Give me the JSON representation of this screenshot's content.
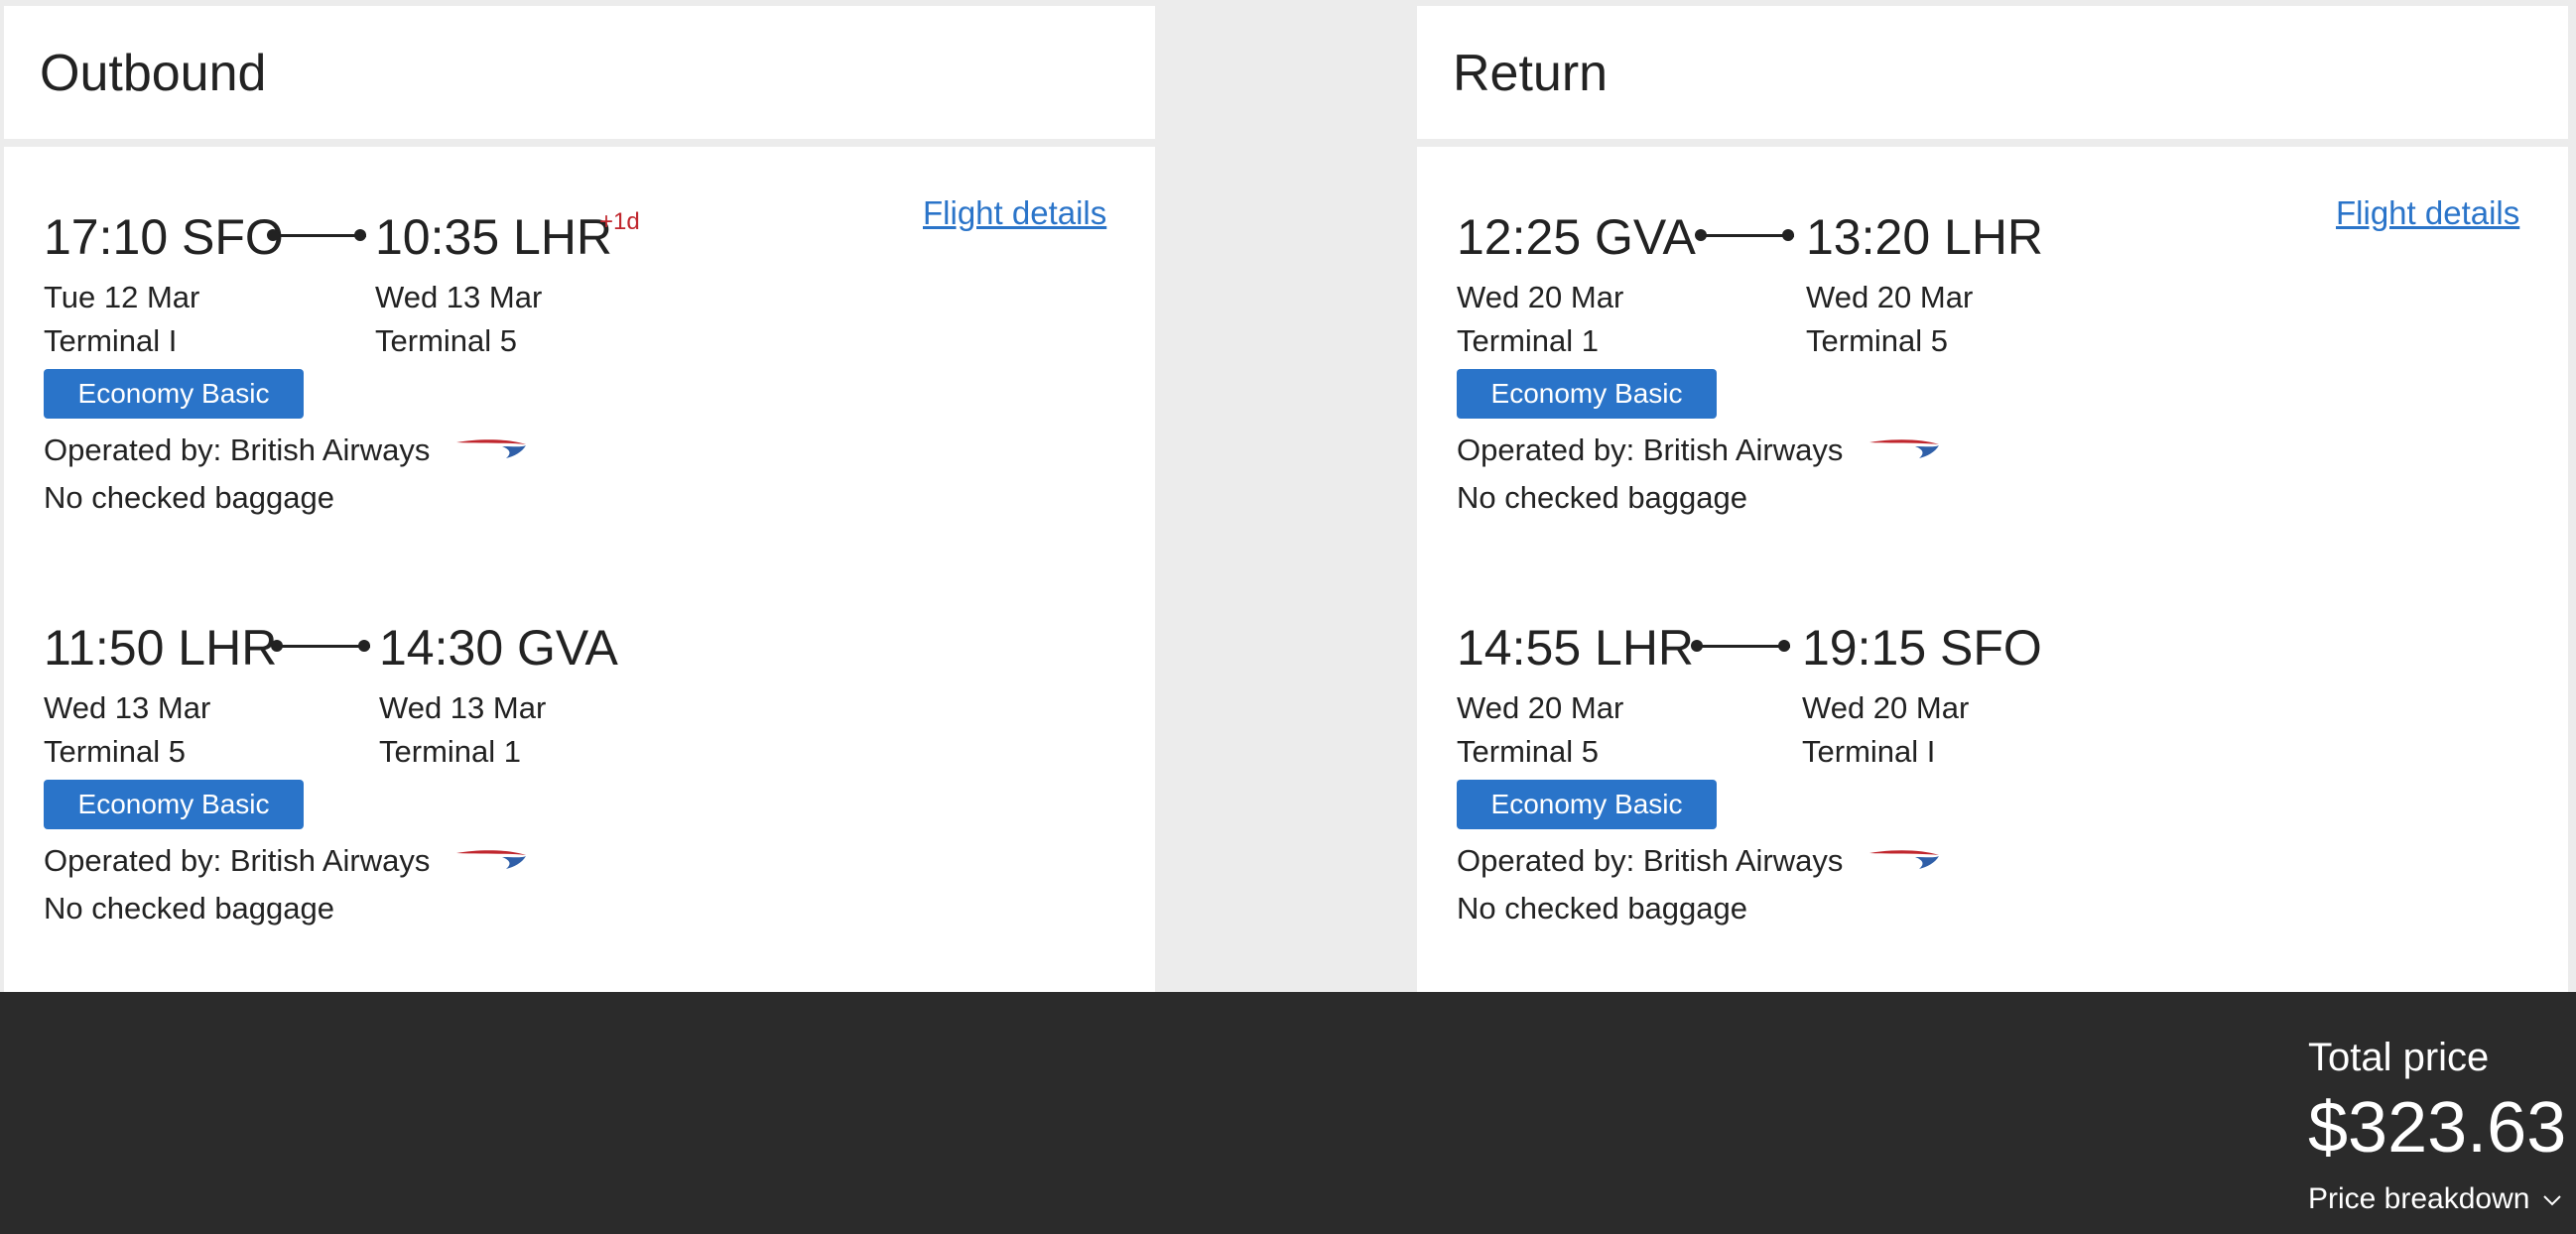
{
  "outbound": {
    "title": "Outbound",
    "flight_details_label": "Flight details",
    "segments": [
      {
        "dep_time": "17:10 SFO",
        "dep_date": "Tue 12 Mar",
        "dep_terminal": "Terminal I",
        "arr_time": "10:35 LHR",
        "arr_day_offset": "+1d",
        "arr_date": "Wed 13 Mar",
        "arr_terminal": "Terminal 5",
        "cabin": "Economy Basic",
        "operated_by": "Operated by: British Airways",
        "baggage": "No checked baggage"
      },
      {
        "dep_time": "11:50 LHR",
        "dep_date": "Wed 13 Mar",
        "dep_terminal": "Terminal 5",
        "arr_time": "14:30 GVA",
        "arr_date": "Wed 13 Mar",
        "arr_terminal": "Terminal 1",
        "cabin": "Economy Basic",
        "operated_by": "Operated by: British Airways",
        "baggage": "No checked baggage"
      }
    ]
  },
  "return": {
    "title": "Return",
    "flight_details_label": "Flight details",
    "segments": [
      {
        "dep_time": "12:25 GVA",
        "dep_date": "Wed 20 Mar",
        "dep_terminal": "Terminal 1",
        "arr_time": "13:20 LHR",
        "arr_date": "Wed 20 Mar",
        "arr_terminal": "Terminal 5",
        "cabin": "Economy Basic",
        "operated_by": "Operated by: British Airways",
        "baggage": "No checked baggage"
      },
      {
        "dep_time": "14:55 LHR",
        "dep_date": "Wed 20 Mar",
        "dep_terminal": "Terminal 5",
        "arr_time": "19:15 SFO",
        "arr_date": "Wed 20 Mar",
        "arr_terminal": "Terminal I",
        "cabin": "Economy Basic",
        "operated_by": "Operated by: British Airways",
        "baggage": "No checked baggage"
      }
    ]
  },
  "footer": {
    "total_label": "Total price",
    "total_price": "$323.63",
    "breakdown_label": "Price breakdown"
  },
  "colors": {
    "accent_blue": "#2a74c9",
    "day_offset_red": "#c0262d",
    "footer_bg": "#2b2b2b",
    "page_bg": "#ececec"
  }
}
